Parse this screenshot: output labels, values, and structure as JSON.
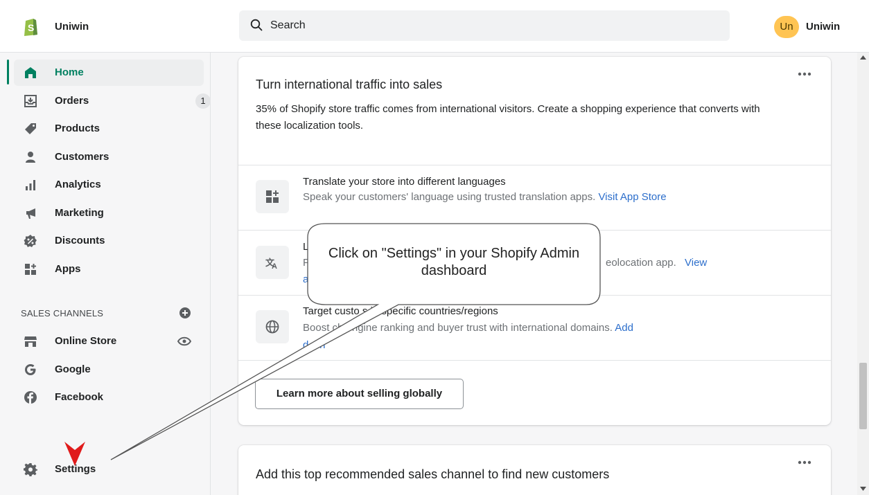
{
  "header": {
    "store_name": "Uniwin",
    "search_placeholder": "Search",
    "avatar_initials": "Un",
    "user_name": "Uniwin"
  },
  "sidebar": {
    "items": [
      {
        "label": "Home",
        "icon": "home-icon",
        "active": true
      },
      {
        "label": "Orders",
        "icon": "orders-icon",
        "badge": "1"
      },
      {
        "label": "Products",
        "icon": "tag-icon"
      },
      {
        "label": "Customers",
        "icon": "person-icon"
      },
      {
        "label": "Analytics",
        "icon": "bar-chart-icon"
      },
      {
        "label": "Marketing",
        "icon": "megaphone-icon"
      },
      {
        "label": "Discounts",
        "icon": "discount-icon"
      },
      {
        "label": "Apps",
        "icon": "apps-icon"
      }
    ],
    "sales_channels_title": "SALES CHANNELS",
    "channels": [
      {
        "label": "Online Store",
        "icon": "store-icon"
      },
      {
        "label": "Google",
        "icon": "google-icon"
      },
      {
        "label": "Facebook",
        "icon": "facebook-icon"
      }
    ],
    "settings_label": "Settings"
  },
  "main": {
    "card1": {
      "title": "Turn international traffic into sales",
      "description": "35% of Shopify store traffic comes from international visitors. Create a shopping experience that converts with these localization tools.",
      "rows": [
        {
          "title": "Translate your store into different languages",
          "desc_before": "Speak your customers' language using trusted translation apps.",
          "link": "Visit App Store",
          "icon": "translate-apps-icon"
        },
        {
          "title": "L",
          "desc_before": "F",
          "desc_after": "eolocation app.",
          "link": "View",
          "link_rest": "a",
          "icon": "language-icon"
        },
        {
          "title": "Target custo    s in specific countries/regions",
          "desc_before": "Boost    ch engine ranking and buyer trust with international domains.",
          "link": "Add",
          "link_rest": "d    ain",
          "icon": "globe-icon"
        }
      ],
      "learn_more_button": "Learn more about selling globally"
    },
    "card2": {
      "title": "Add this top recommended sales channel to find new customers"
    }
  },
  "callout": {
    "text": "Click on \"Settings\" in your Shopify Admin dashboard"
  },
  "colors": {
    "accent_green": "#008060",
    "link_blue": "#2c6ecb",
    "avatar_bg": "#ffc453",
    "arrow_red": "#e01b1b"
  }
}
